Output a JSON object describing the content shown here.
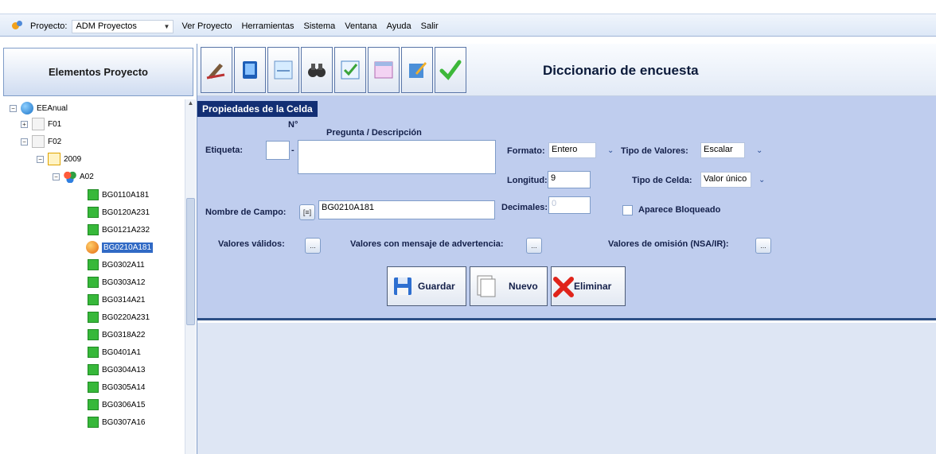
{
  "menubar": {
    "project_label": "Proyecto:",
    "project_value": "ADM Proyectos",
    "items": [
      "Ver Proyecto",
      "Herramientas",
      "Sistema",
      "Ventana",
      "Ayuda",
      "Salir"
    ]
  },
  "left_panel": {
    "header": "Elementos Proyecto",
    "tree": {
      "root": "EEAnual",
      "f01": "F01",
      "f02": "F02",
      "year": "2009",
      "group": "A02",
      "items": [
        "BG0110A181",
        "BG0120A231",
        "BG0121A232",
        "BG0210A181",
        "BG0302A11",
        "BG0303A12",
        "BG0314A21",
        "BG0220A231",
        "BG0318A22",
        "BG0401A1",
        "BG0304A13",
        "BG0305A14",
        "BG0306A15",
        "BG0307A16"
      ],
      "selected": "BG0210A181"
    }
  },
  "toolbar": {
    "title": "Diccionario de encuesta",
    "icons": [
      "edit-icon",
      "monitor-icon",
      "form-icon",
      "binoculars-icon",
      "checklist-icon",
      "table-icon",
      "notepad-icon",
      "check-icon"
    ]
  },
  "props": {
    "header": "Propiedades de la Celda",
    "n_label": "N°",
    "pregunta_label": "Pregunta / Descripción",
    "etiqueta_label": "Etiqueta:",
    "etiqueta_value": "",
    "dash": "-",
    "pregunta_value": "",
    "formato_label": "Formato:",
    "formato_value": "Entero",
    "tipo_valores_label": "Tipo de Valores:",
    "tipo_valores_value": "Escalar",
    "longitud_label": "Longitud:",
    "longitud_value": "9",
    "tipo_celda_label": "Tipo de Celda:",
    "tipo_celda_value": "Valor único",
    "nombre_campo_label": "Nombre de Campo:",
    "nombre_campo_value": "BG0210A181",
    "decimales_label": "Decimales:",
    "decimales_value": "0",
    "aparece_bloqueado_label": "Aparece Bloqueado",
    "valores_validos_label": "Valores válidos:",
    "valores_advertencia_label": "Valores con mensaje de advertencia:",
    "valores_omision_label": "Valores de omisión (NSA/IR):",
    "ellipsis": "...",
    "list_glyph": "[≡]",
    "guardar": "Guardar",
    "nuevo": "Nuevo",
    "eliminar": "Eliminar"
  },
  "colors": {
    "panel_bg": "#bfcdee",
    "header_bg": "#132f74",
    "selection": "#316ac5"
  }
}
